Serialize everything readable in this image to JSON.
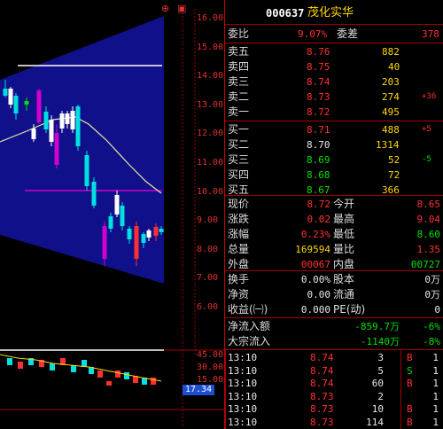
{
  "stock": {
    "code": "000637",
    "name": "茂化实华"
  },
  "price_axis": [
    "16.00",
    "15.00",
    "14.00",
    "13.00",
    "12.00",
    "11.00",
    "10.00",
    "9.00",
    "8.00",
    "7.00",
    "6.00"
  ],
  "volume_axis": [
    "45.00",
    "30.00",
    "15.00"
  ],
  "indicator_value": "17.34",
  "top_icons": [
    "⊕",
    "▣"
  ],
  "ratio": {
    "wb_label": "委比",
    "wb_value": "9.07%",
    "wc_label": "委差",
    "wc_value": "378"
  },
  "sell_orders": [
    {
      "label": "卖五",
      "price": "8.76",
      "vol": "882",
      "chg": ""
    },
    {
      "label": "卖四",
      "price": "8.75",
      "vol": "40",
      "chg": ""
    },
    {
      "label": "卖三",
      "price": "8.74",
      "vol": "203",
      "chg": ""
    },
    {
      "label": "卖二",
      "price": "8.73",
      "vol": "274",
      "chg": "+36"
    },
    {
      "label": "卖一",
      "price": "8.72",
      "vol": "495",
      "chg": ""
    }
  ],
  "buy_orders": [
    {
      "label": "买一",
      "price": "8.71",
      "vol": "488",
      "chg": "+5"
    },
    {
      "label": "买二",
      "price": "8.70",
      "vol": "1314",
      "chg": ""
    },
    {
      "label": "买三",
      "price": "8.69",
      "vol": "52",
      "chg": "-5"
    },
    {
      "label": "买四",
      "price": "8.68",
      "vol": "72",
      "chg": ""
    },
    {
      "label": "买五",
      "price": "8.67",
      "vol": "366",
      "chg": ""
    }
  ],
  "quote": [
    {
      "l1": "现价",
      "v1": "8.72",
      "l2": "今开",
      "v2": "8.65"
    },
    {
      "l1": "涨跌",
      "v1": "0.02",
      "l2": "最高",
      "v2": "9.04"
    },
    {
      "l1": "涨幅",
      "v1": "0.23%",
      "l2": "最低",
      "v2": "8.60"
    },
    {
      "l1": "总量",
      "v1": "169594",
      "l2": "量比",
      "v2": "1.35"
    },
    {
      "l1": "外盘",
      "v1": "00067",
      "l2": "内盘",
      "v2": "00727"
    }
  ],
  "extra": [
    {
      "l1": "换手",
      "v1": "0.00%",
      "l2": "股本",
      "v2": "0万"
    },
    {
      "l1": "净资",
      "v1": "0.00",
      "l2": "流通",
      "v2": "0万"
    },
    {
      "l1": "收益(㈠)",
      "v1": "0.000",
      "l2": "PE(动)",
      "v2": "0"
    }
  ],
  "flows": [
    {
      "label": "净流入额",
      "value": "-859.7万",
      "pct": "-6%"
    },
    {
      "label": "大宗流入",
      "value": "-1140万",
      "pct": "-8%"
    }
  ],
  "ticks": [
    {
      "time": "13:10",
      "price": "8.74",
      "vol": "3",
      "flag": "B",
      "n": "1"
    },
    {
      "time": "13:10",
      "price": "8.74",
      "vol": "5",
      "flag": "S",
      "n": "1"
    },
    {
      "time": "13:10",
      "price": "8.74",
      "vol": "60",
      "flag": "B",
      "n": "1"
    },
    {
      "time": "13:10",
      "price": "8.73",
      "vol": "2",
      "flag": "",
      "n": "1"
    },
    {
      "time": "13:10",
      "price": "8.73",
      "vol": "10",
      "flag": "B",
      "n": "1"
    },
    {
      "time": "13:10",
      "price": "8.73",
      "vol": "114",
      "flag": "B",
      "n": "1"
    }
  ]
}
